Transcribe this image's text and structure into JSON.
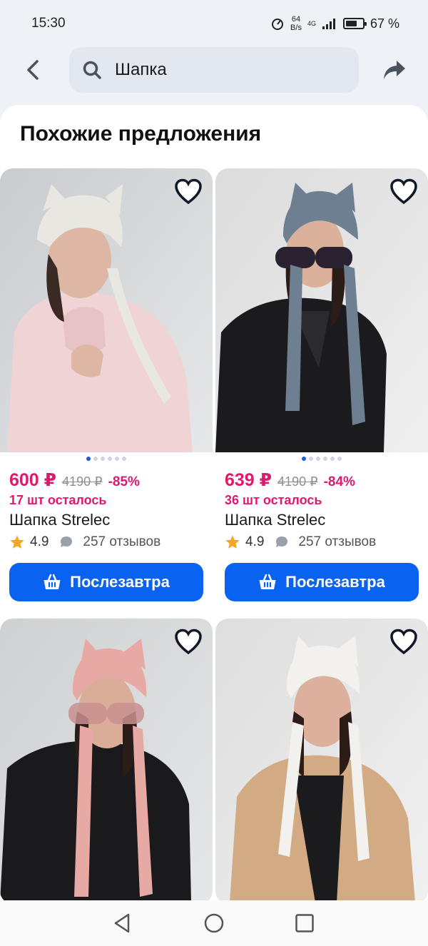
{
  "status": {
    "time": "15:30",
    "net_speed_value": "64",
    "net_speed_unit": "B/s",
    "signal_label": "4G",
    "battery_percent": "67 %",
    "battery_level": 0.67
  },
  "search": {
    "query": "Шапка"
  },
  "section": {
    "title": "Похожие предложения"
  },
  "products": [
    {
      "price": "600 ₽",
      "old_price": "4190 ₽",
      "discount": "-85%",
      "stock": "17 шт осталось",
      "name": "Шапка Strelec",
      "rating": "4.9",
      "reviews": "257 отзывов",
      "button_label": "Послезавтра",
      "hat_color": "#e9e7e2",
      "outfit": "pink-sweater"
    },
    {
      "price": "639 ₽",
      "old_price": "4190 ₽",
      "discount": "-84%",
      "stock": "36 шт осталось",
      "name": "Шапка Strelec",
      "rating": "4.9",
      "reviews": "257 отзывов",
      "button_label": "Послезавтра",
      "hat_color": "#6f7f92",
      "outfit": "black-leather-jacket"
    },
    {
      "hat_color": "#e7a9a4",
      "outfit": "black-leather-jacket"
    },
    {
      "hat_color": "#f3f1ee",
      "outfit": "beige-trench-coat"
    }
  ],
  "colors": {
    "accent": "#0a62f0",
    "price": "#e0196d",
    "star": "#f5a623"
  }
}
